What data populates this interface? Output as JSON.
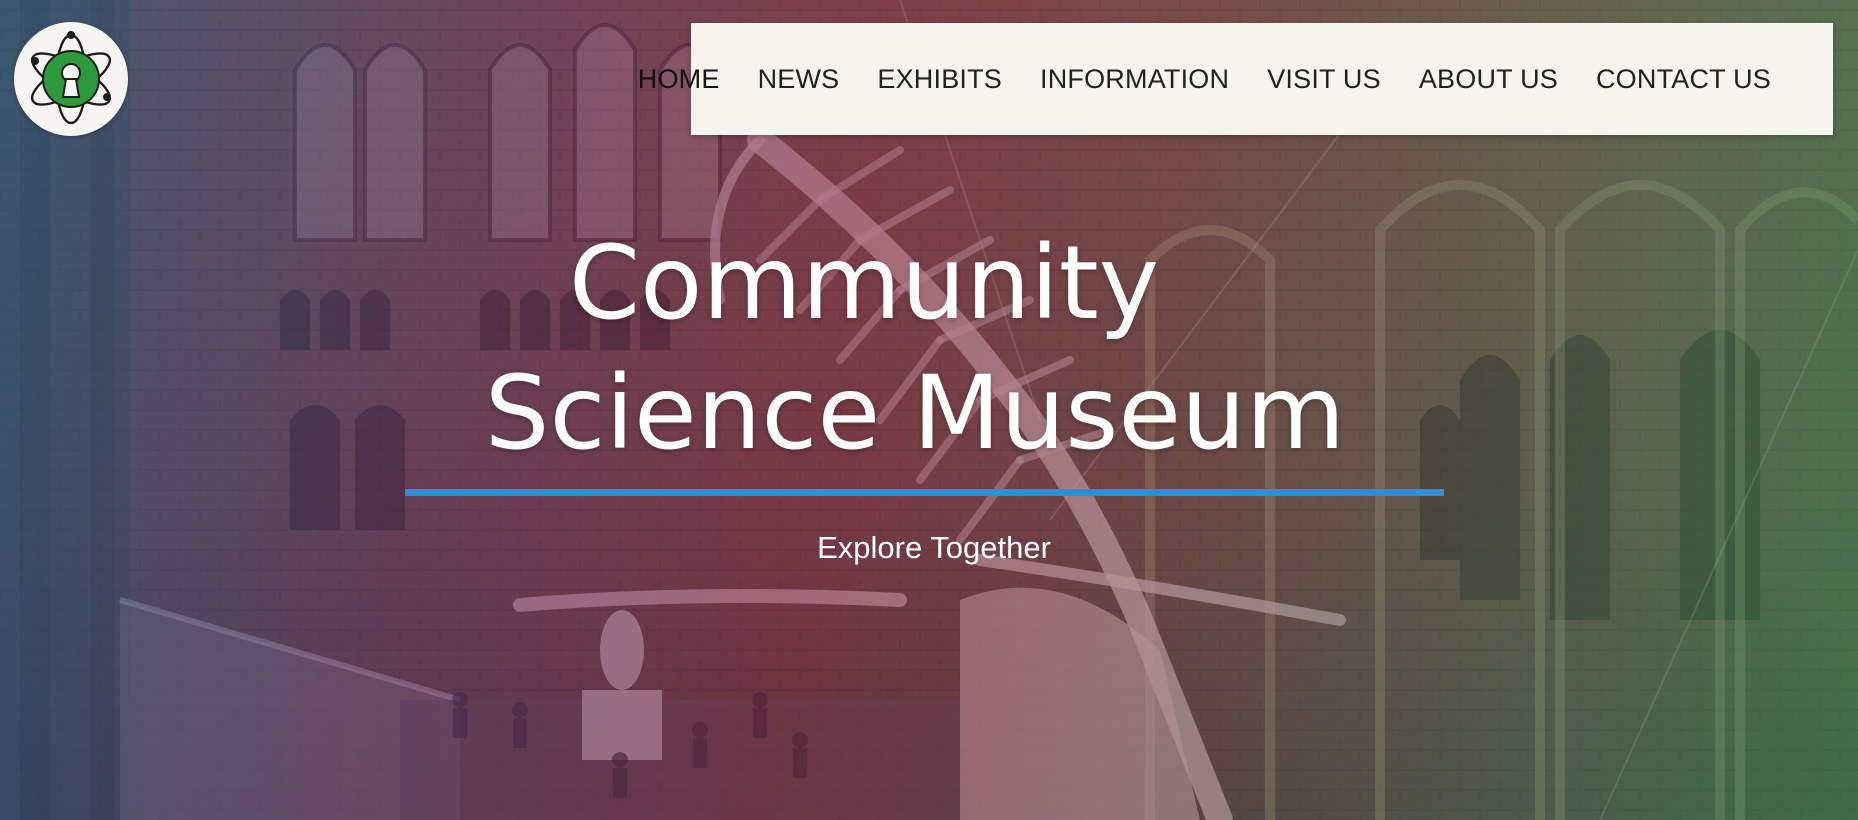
{
  "logo": {
    "icon": "atom-keyhole-icon",
    "colors": {
      "green": "#2e9a3e",
      "outline": "#1d1d1d"
    }
  },
  "nav": {
    "items": [
      {
        "label": "HOME",
        "active": true
      },
      {
        "label": "NEWS"
      },
      {
        "label": "EXHIBITS"
      },
      {
        "label": "INFORMATION"
      },
      {
        "label": "VISIT US"
      },
      {
        "label": "ABOUT US"
      },
      {
        "label": "CONTACT US"
      }
    ]
  },
  "hero": {
    "title_line1": "Community",
    "title_line2": "Science Museum",
    "tagline": "Explore Together",
    "background": "museum-hall-whale-skeleton-photo",
    "accent": "#2f8fd6"
  }
}
